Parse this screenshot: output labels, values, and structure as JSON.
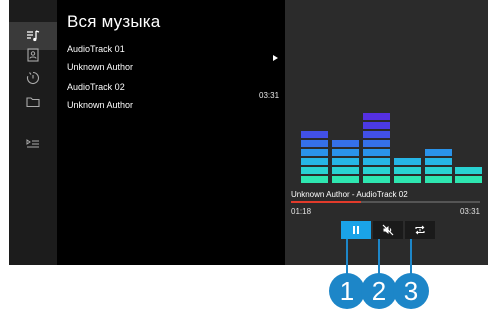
{
  "sidebar": {
    "items": [
      {
        "icon": "music-list-icon",
        "active": true
      },
      {
        "icon": "contact-card-icon",
        "active": false
      },
      {
        "icon": "recent-clock-icon",
        "active": false
      },
      {
        "icon": "folder-icon",
        "active": false
      },
      {
        "icon": "playlist-icon",
        "active": false
      }
    ]
  },
  "list": {
    "title": "Вся музыка",
    "tracks": [
      {
        "title": "AudioTrack 01",
        "author": "Unknown Author",
        "duration": ""
      },
      {
        "title": "AudioTrack 02",
        "author": "Unknown Author",
        "duration": "03:31"
      }
    ]
  },
  "player": {
    "now_playing": "Unknown Author - AudioTrack 02",
    "elapsed": "01:18",
    "total": "03:31",
    "progress": 0.37,
    "controls": {
      "pause": "pause-icon",
      "mute": "mute-icon",
      "repeat": "repeat-icon"
    }
  },
  "equalizer": {
    "levels": [
      6,
      5,
      8,
      3,
      4,
      2,
      4
    ],
    "colors": {
      "top": "#5a2be0",
      "bottom": "#2be0b0"
    }
  },
  "callouts": [
    "1",
    "2",
    "3"
  ],
  "colors": {
    "accent": "#1aa3e8",
    "progress": "#e23b2b",
    "callout": "#1d86c8"
  }
}
